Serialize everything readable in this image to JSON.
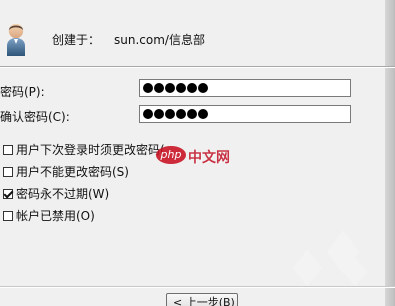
{
  "header": {
    "created_label": "创建于：",
    "created_value": "sun.com/信息部"
  },
  "form": {
    "password_label": "密码(P):",
    "confirm_label": "确认密码(C):",
    "password_value": "●●●●●●",
    "confirm_value": "●●●●●●"
  },
  "options": [
    {
      "label": "用户下次登录时须更改密码(",
      "checked": false
    },
    {
      "label": "用户不能更改密码(S)",
      "checked": false
    },
    {
      "label": "密码永不过期(W)",
      "checked": true
    },
    {
      "label": "帐户已禁用(O)",
      "checked": false
    }
  ],
  "footer": {
    "back_label": "< 上一步(B)"
  },
  "watermark": {
    "badge": "php",
    "text": "中文网"
  },
  "icons": {
    "avatar": "user-avatar-icon",
    "checkbox": "checkbox-icon"
  },
  "colors": {
    "window_bg": "#f0f0f0",
    "input_border": "#7a7a7a",
    "watermark_red": "#c90f22"
  }
}
